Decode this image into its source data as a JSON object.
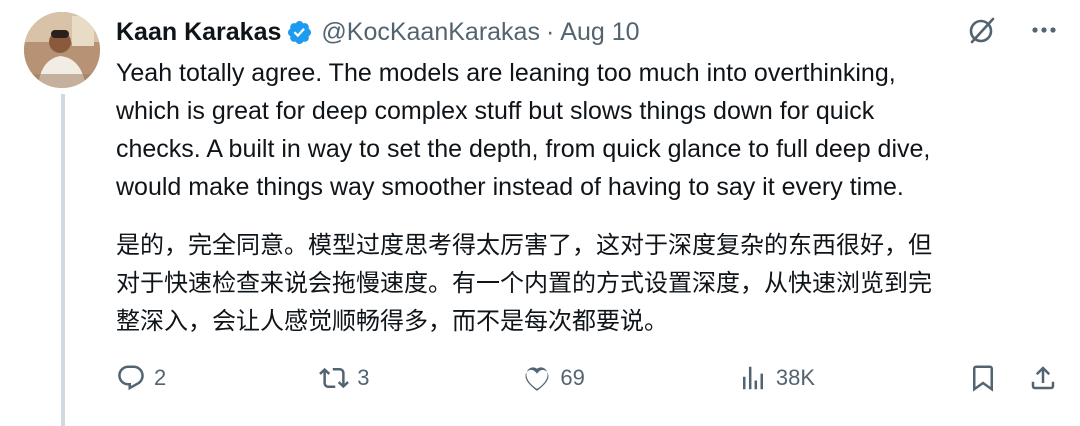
{
  "author": {
    "display_name": "Kaan Karakas",
    "handle": "@KocKaanKarakas",
    "separator": "·",
    "date": "Aug 10",
    "verified": true
  },
  "tweet": {
    "text_en": "Yeah totally agree. The models are leaning too much into overthinking,\nwhich is great for deep complex stuff but slows things down for quick\nchecks. A built in way to set the depth, from quick glance to full deep dive,\nwould make things way smoother instead of having to say it every time.",
    "text_zh": "是的，完全同意。模型过度思考得太厉害了，这对于深度复杂的东西很好，但\n对于快速检查来说会拖慢速度。有一个内置的方式设置深度，从快速浏览到完\n整深入，会让人感觉顺畅得多，而不是每次都要说。"
  },
  "actions": {
    "replies": "2",
    "reposts": "3",
    "likes": "69",
    "views": "38K"
  },
  "icons": {
    "top": [
      "grok-slash-icon",
      "more-icon"
    ],
    "bar": [
      "reply-icon",
      "repost-icon",
      "like-icon",
      "views-icon",
      "bookmark-icon",
      "share-icon"
    ]
  },
  "colors": {
    "text": "#0f1419",
    "muted": "#536471",
    "verified": "#1d9bf0",
    "thread_line": "#cfd9de"
  }
}
